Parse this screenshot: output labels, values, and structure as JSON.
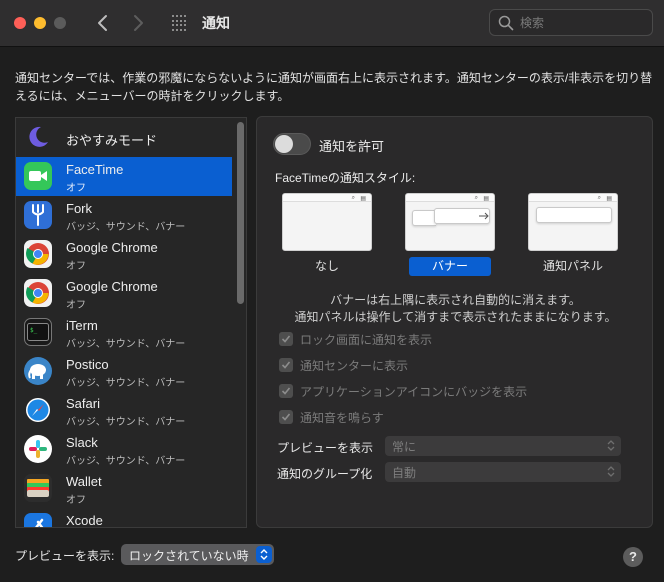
{
  "window": {
    "title": "通知",
    "search_placeholder": "検索"
  },
  "description": "通知センターでは、作業の邪魔にならないように通知が画面右上に表示されます。通知センターの表示/非表示を切り替えるには、メニューバーの時計をクリックします。",
  "apps": [
    {
      "name": "おやすみモード",
      "subtitle": "",
      "icon": "moon-icon",
      "color": "#5b5bd6",
      "selected": false
    },
    {
      "name": "FaceTime",
      "subtitle": "オフ",
      "icon": "facetime-icon",
      "color": "#34c759",
      "selected": true
    },
    {
      "name": "Fork",
      "subtitle": "バッジ、サウンド、バナー",
      "icon": "fork-icon",
      "color": "#2f6fd6",
      "selected": false
    },
    {
      "name": "Google Chrome",
      "subtitle": "オフ",
      "icon": "chrome-icon",
      "color": "#ffffff",
      "selected": false
    },
    {
      "name": "Google Chrome",
      "subtitle": "オフ",
      "icon": "chrome-icon",
      "color": "#ffffff",
      "selected": false
    },
    {
      "name": "iTerm",
      "subtitle": "バッジ、サウンド、バナー",
      "icon": "terminal-icon",
      "color": "#1f1f1f",
      "selected": false
    },
    {
      "name": "Postico",
      "subtitle": "バッジ、サウンド、バナー",
      "icon": "elephant-icon",
      "color": "#3a85c8",
      "selected": false
    },
    {
      "name": "Safari",
      "subtitle": "バッジ、サウンド、バナー",
      "icon": "compass-icon",
      "color": "#1e88e5",
      "selected": false
    },
    {
      "name": "Slack",
      "subtitle": "バッジ、サウンド、バナー",
      "icon": "slack-icon",
      "color": "#ffffff",
      "selected": false
    },
    {
      "name": "Wallet",
      "subtitle": "オフ",
      "icon": "wallet-icon",
      "color": "#3a3a3a",
      "selected": false
    },
    {
      "name": "Xcode",
      "subtitle": "",
      "icon": "xcode-icon",
      "color": "#1b76e0",
      "selected": false
    }
  ],
  "panel": {
    "allow_label": "通知を許可",
    "allow_on": false,
    "style_label": "FaceTimeの通知スタイル:",
    "styles": [
      {
        "label": "なし",
        "selected": false
      },
      {
        "label": "バナー",
        "selected": true
      },
      {
        "label": "通知パネル",
        "selected": false
      }
    ],
    "explain_line1": "バナーは右上隅に表示され自動的に消えます。",
    "explain_line2": "通知パネルは操作して消すまで表示されたままになります。",
    "checks": [
      {
        "label": "ロック画面に通知を表示",
        "checked": true
      },
      {
        "label": "通知センターに表示",
        "checked": true
      },
      {
        "label": "アプリケーションアイコンにバッジを表示",
        "checked": true
      },
      {
        "label": "通知音を鳴らす",
        "checked": true
      }
    ],
    "preview_label": "プレビューを表示",
    "preview_value": "常に",
    "group_label": "通知のグループ化",
    "group_value": "自動"
  },
  "bottom": {
    "preview_label": "プレビューを表示:",
    "preview_value": "ロックされていない時"
  },
  "help_label": "?",
  "colors": {
    "accent": "#0a5fd1",
    "background": "#1e1e1e",
    "panel": "#2a292a"
  }
}
